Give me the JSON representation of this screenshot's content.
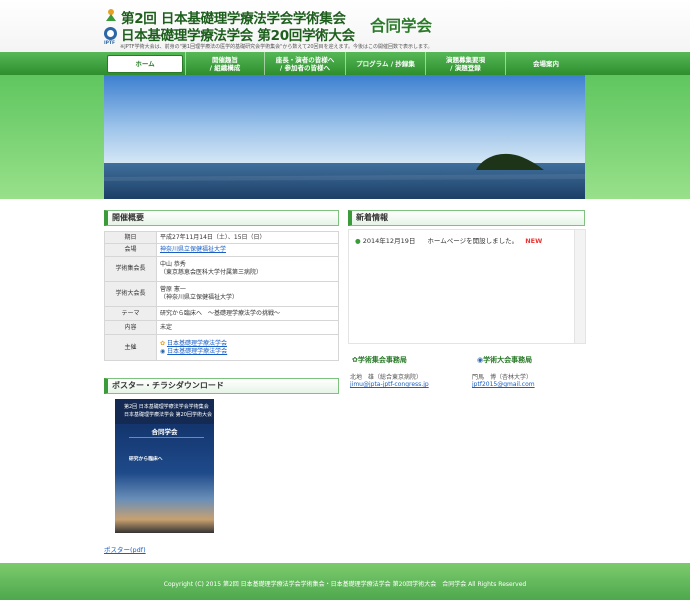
{
  "header": {
    "title_line_1": "第2回 日本基礎理学療法学会学術集会",
    "title_line_2": "日本基礎理学療法学会 第20回学術大会",
    "joint_label": "合同学会",
    "logo_tag": "IPTF",
    "note": "※JPTF学術大会は、前身の\"第1回理学療法の医学的基礎研究会学術集会\"から数えて20回目を迎えます。今後はこの開催回数で表示します。"
  },
  "nav": {
    "items": [
      {
        "label": "ホーム",
        "active": true
      },
      {
        "label": "開催趣旨\n/ 組織構成"
      },
      {
        "label": "座長・演者の皆様へ\n/ 参加者の皆様へ"
      },
      {
        "label": "プログラム / 抄録集"
      },
      {
        "label": "演題募集要項\n/ 演題登録"
      },
      {
        "label": "会場案内"
      }
    ]
  },
  "colors": {
    "brand_green": "#2e8e2e",
    "link": "#1a5fc4",
    "new": "#e33333"
  },
  "overview": {
    "title": "開催概要",
    "rows": [
      {
        "key": "期日",
        "value": "平成27年11月14日（土）、15日（日）"
      },
      {
        "key": "会場",
        "value": "神奈川県立保健福祉大学"
      },
      {
        "key": "学術集会長",
        "value_1": "中山 恭秀",
        "value_2": "（東京慈恵会医科大学付属第三病院）"
      },
      {
        "key": "学術大会長",
        "value_1": "菅原 憲一",
        "value_2": "（神奈川県立保健福祉大学）"
      },
      {
        "key": "テーマ",
        "value": "研究から臨床へ　〜基礎理学療法学の挑戦〜"
      },
      {
        "key": "内容",
        "value": "未定"
      },
      {
        "key": "主催",
        "value_1": "日本基礎理学療法学会",
        "value_2": "日本基礎理学療法学会"
      }
    ]
  },
  "news": {
    "title": "新着情報",
    "items": [
      {
        "date": "2014年12月19日",
        "text": "ホームページを開設しました。",
        "badge": "NEW"
      }
    ]
  },
  "office": {
    "society": {
      "heading": "学術集会事務局",
      "name": "北地　雄（総合東京病院）",
      "email": "jimu@jpta-jptf-congress.jp"
    },
    "congress": {
      "heading": "学術大会事務局",
      "name": "門馬　博（杏林大学）",
      "email": "jptf2015@gmail.com"
    }
  },
  "poster": {
    "title": "ポスター・チラシダウンロード",
    "line_1": "第2回 日本基礎理学療法学会学術集会",
    "line_2": "日本基礎理学療法学会 第20回学術大会",
    "joint": "合同学会",
    "theme": "研究から臨床へ",
    "link": "ポスター(pdf)"
  },
  "footer": {
    "copyright": "Copyright (C) 2015 第2回 日本基礎理学療法学会学術集会・日本基礎理学療法学会 第20回学術大会　合同学会 All Rights Reserved"
  }
}
